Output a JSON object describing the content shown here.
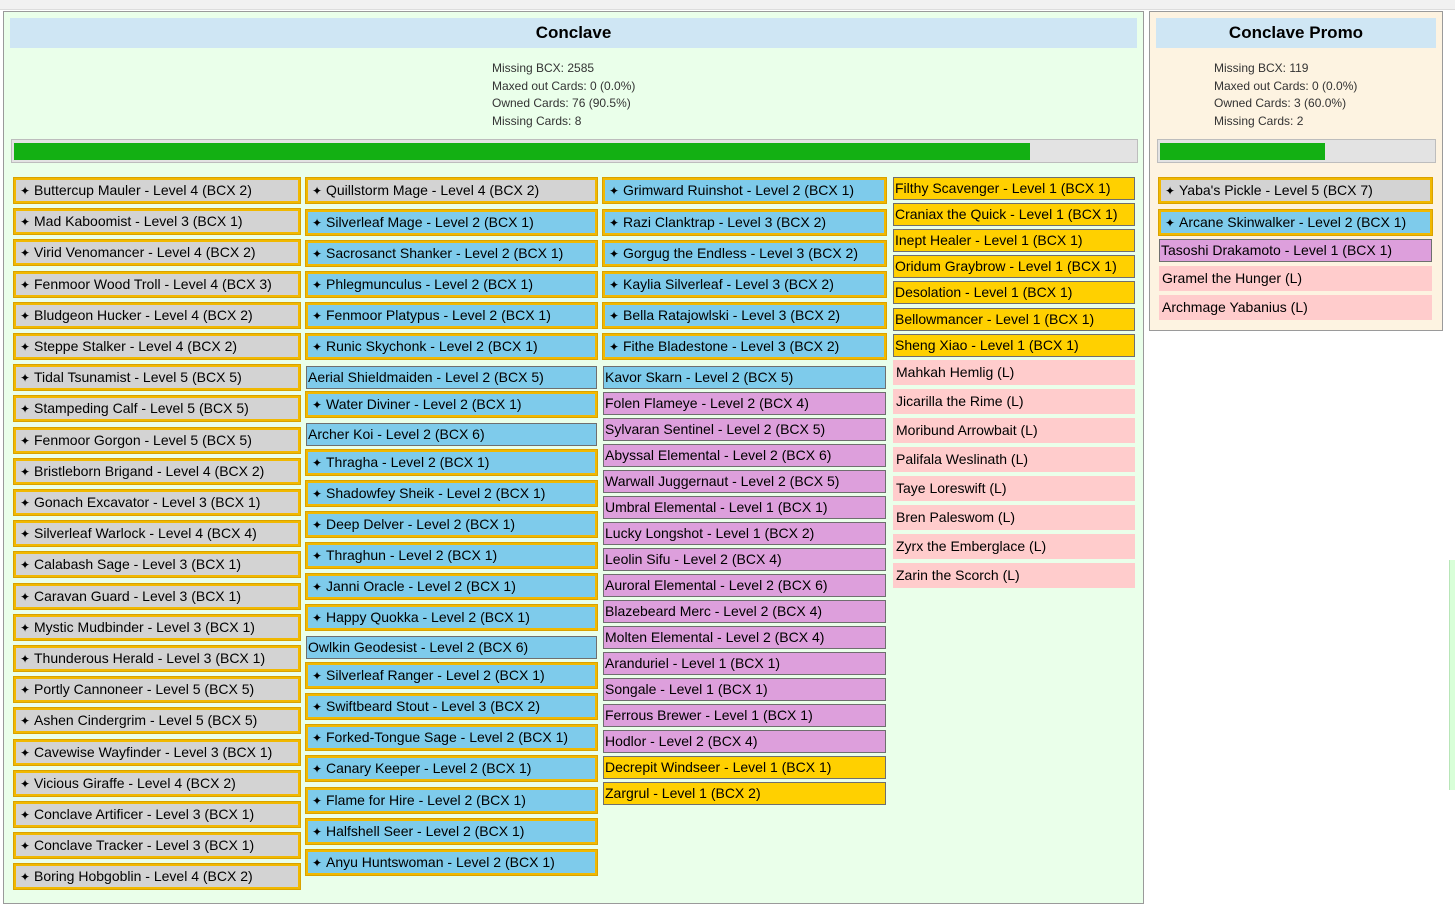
{
  "panels": {
    "main": {
      "title": "Conclave",
      "stats": [
        "Missing BCX: 2585",
        "Maxed out Cards: 0 (0.0%)",
        "Owned Cards: 76 (90.5%)",
        "Missing Cards: 8"
      ],
      "progress": 0.905,
      "columns": [
        {
          "color": "gray",
          "cards": [
            {
              "label": "Buttercup Mauler - Level 4 (BCX 2)",
              "icon": "star-icon",
              "style": "star"
            },
            {
              "label": "Mad Kaboomist - Level 3 (BCX 1)",
              "icon": "star-icon",
              "style": "star"
            },
            {
              "label": "Virid Venomancer - Level 4 (BCX 2)",
              "icon": "star-icon",
              "style": "star"
            },
            {
              "label": "Fenmoor Wood Troll - Level 4 (BCX 3)",
              "icon": "star-icon",
              "style": "star"
            },
            {
              "label": "Bludgeon Hucker - Level 4 (BCX 2)",
              "icon": "star-icon",
              "style": "star"
            },
            {
              "label": "Steppe Stalker - Level 4 (BCX 2)",
              "icon": "star-icon",
              "style": "star"
            },
            {
              "label": "Tidal Tsunamist - Level 5 (BCX 5)",
              "icon": "star-icon",
              "style": "star"
            },
            {
              "label": "Stampeding Calf - Level 5 (BCX 5)",
              "icon": "star-icon",
              "style": "star"
            },
            {
              "label": "Fenmoor Gorgon - Level 5 (BCX 5)",
              "icon": "star-icon",
              "style": "star"
            },
            {
              "label": "Bristleborn Brigand - Level 4 (BCX 2)",
              "icon": "star-icon",
              "style": "star"
            },
            {
              "label": "Gonach Excavator - Level 3 (BCX 1)",
              "icon": "star-icon",
              "style": "star"
            },
            {
              "label": "Silverleaf Warlock - Level 4 (BCX 4)",
              "icon": "star-icon",
              "style": "star"
            },
            {
              "label": "Calabash Sage - Level 3 (BCX 1)",
              "icon": "star-icon",
              "style": "star"
            },
            {
              "label": "Caravan Guard - Level 3 (BCX 1)",
              "icon": "star-icon",
              "style": "star"
            },
            {
              "label": "Mystic Mudbinder - Level 3 (BCX 1)",
              "icon": "star-icon",
              "style": "star"
            },
            {
              "label": "Thunderous Herald - Level 3 (BCX 1)",
              "icon": "star-icon",
              "style": "star"
            },
            {
              "label": "Portly Cannoneer - Level 5 (BCX 5)",
              "icon": "star-icon",
              "style": "star"
            },
            {
              "label": "Ashen Cindergrim - Level 5 (BCX 5)",
              "icon": "star-icon",
              "style": "star"
            },
            {
              "label": "Cavewise Wayfinder - Level 3 (BCX 1)",
              "icon": "star-icon",
              "style": "star"
            },
            {
              "label": "Vicious Giraffe - Level 4 (BCX 2)",
              "icon": "star-icon",
              "style": "star"
            },
            {
              "label": "Conclave Artificer - Level 3 (BCX 1)",
              "icon": "star-icon",
              "style": "star"
            },
            {
              "label": "Conclave Tracker - Level 3 (BCX 1)",
              "icon": "star-icon",
              "style": "star"
            },
            {
              "label": "Boring Hobgoblin - Level 4 (BCX 2)",
              "icon": "star-icon",
              "style": "star"
            }
          ]
        },
        {
          "color": "blue",
          "cards": [
            {
              "label": "Quillstorm Mage - Level 4 (BCX 2)",
              "icon": "star-icon",
              "style": "star",
              "bg": "gray"
            },
            {
              "label": "Silverleaf Mage - Level 2 (BCX 1)",
              "icon": "star-icon",
              "style": "star"
            },
            {
              "label": "Sacrosanct Shanker - Level 2 (BCX 1)",
              "icon": "star-icon",
              "style": "star"
            },
            {
              "label": "Phlegmunculus - Level 2 (BCX 1)",
              "icon": "star-icon",
              "style": "star"
            },
            {
              "label": "Fenmoor Platypus - Level 2 (BCX 1)",
              "icon": "star-icon",
              "style": "star"
            },
            {
              "label": "Runic Skychonk - Level 2 (BCX 1)",
              "icon": "star-icon",
              "style": "star"
            },
            {
              "label": "Aerial Shieldmaiden - Level 2 (BCX 5)",
              "icon": "",
              "style": "plain"
            },
            {
              "label": "Water Diviner - Level 2 (BCX 1)",
              "icon": "star-icon",
              "style": "star"
            },
            {
              "label": "Archer Koi - Level 2 (BCX 6)",
              "icon": "",
              "style": "plain"
            },
            {
              "label": "Thragha - Level 2 (BCX 1)",
              "icon": "star-icon",
              "style": "star"
            },
            {
              "label": "Shadowfey Sheik - Level 2 (BCX 1)",
              "icon": "star-icon",
              "style": "star"
            },
            {
              "label": "Deep Delver - Level 2 (BCX 1)",
              "icon": "star-icon",
              "style": "star"
            },
            {
              "label": "Thraghun - Level 2 (BCX 1)",
              "icon": "star-icon",
              "style": "star"
            },
            {
              "label": "Janni Oracle - Level 2 (BCX 1)",
              "icon": "star-icon",
              "style": "star"
            },
            {
              "label": "Happy Quokka - Level 2 (BCX 1)",
              "icon": "star-icon",
              "style": "star"
            },
            {
              "label": "Owlkin Geodesist - Level 2 (BCX 6)",
              "icon": "",
              "style": "plain"
            },
            {
              "label": "Silverleaf Ranger - Level 2 (BCX 1)",
              "icon": "star-icon",
              "style": "star"
            },
            {
              "label": "Swiftbeard Stout - Level 3 (BCX 2)",
              "icon": "star-icon",
              "style": "star"
            },
            {
              "label": "Forked-Tongue Sage - Level 2 (BCX 1)",
              "icon": "star-icon",
              "style": "star"
            },
            {
              "label": "Canary Keeper - Level 2 (BCX 1)",
              "icon": "star-icon",
              "style": "star"
            },
            {
              "label": "Flame for Hire - Level 2 (BCX 1)",
              "icon": "star-icon",
              "style": "star"
            },
            {
              "label": "Halfshell Seer - Level 2 (BCX 1)",
              "icon": "star-icon",
              "style": "star"
            },
            {
              "label": "Anyu Huntswoman - Level 2 (BCX 1)",
              "icon": "star-icon",
              "style": "star"
            }
          ]
        },
        {
          "color": "blue",
          "cards": [
            {
              "label": "Grimward Ruinshot - Level 2 (BCX 1)",
              "icon": "star-icon",
              "style": "star"
            },
            {
              "label": "Razi Clanktrap - Level 3 (BCX 2)",
              "icon": "star-icon",
              "style": "star"
            },
            {
              "label": "Gorgug the Endless - Level 3 (BCX 2)",
              "icon": "star-icon",
              "style": "star"
            },
            {
              "label": "Kaylia Silverleaf - Level 3 (BCX 2)",
              "icon": "star-icon",
              "style": "star"
            },
            {
              "label": "Bella Ratajowlski - Level 3 (BCX 2)",
              "icon": "star-icon",
              "style": "star"
            },
            {
              "label": "Fithe Bladestone - Level 3 (BCX 2)",
              "icon": "star-icon",
              "style": "star"
            },
            {
              "label": "Kavor Skarn - Level 2 (BCX 5)",
              "icon": "",
              "style": "plain",
              "bg": "blue"
            },
            {
              "label": "Folen Flameye - Level 2 (BCX 4)",
              "icon": "",
              "style": "plain",
              "bg": "purple"
            },
            {
              "label": "Sylvaran Sentinel - Level 2 (BCX 5)",
              "icon": "",
              "style": "plain",
              "bg": "purple"
            },
            {
              "label": "Abyssal Elemental - Level 2 (BCX 6)",
              "icon": "",
              "style": "plain",
              "bg": "purple"
            },
            {
              "label": "Warwall Juggernaut - Level 2 (BCX 5)",
              "icon": "",
              "style": "plain",
              "bg": "purple"
            },
            {
              "label": "Umbral Elemental - Level 1 (BCX 1)",
              "icon": "",
              "style": "plain",
              "bg": "purple"
            },
            {
              "label": "Lucky Longshot - Level 1 (BCX 2)",
              "icon": "",
              "style": "plain",
              "bg": "purple"
            },
            {
              "label": "Leolin Sifu - Level 2 (BCX 4)",
              "icon": "",
              "style": "plain",
              "bg": "purple"
            },
            {
              "label": "Auroral Elemental - Level 2 (BCX 6)",
              "icon": "",
              "style": "plain",
              "bg": "purple"
            },
            {
              "label": "Blazebeard Merc - Level 2 (BCX 4)",
              "icon": "",
              "style": "plain",
              "bg": "purple"
            },
            {
              "label": "Molten Elemental - Level 2 (BCX 4)",
              "icon": "",
              "style": "plain",
              "bg": "purple"
            },
            {
              "label": "Aranduriel - Level 1 (BCX 1)",
              "icon": "",
              "style": "plain",
              "bg": "purple"
            },
            {
              "label": "Songale - Level 1 (BCX 1)",
              "icon": "",
              "style": "plain",
              "bg": "purple"
            },
            {
              "label": "Ferrous Brewer - Level 1 (BCX 1)",
              "icon": "",
              "style": "plain",
              "bg": "purple"
            },
            {
              "label": "Hodlor - Level 2 (BCX 4)",
              "icon": "",
              "style": "plain",
              "bg": "purple"
            },
            {
              "label": "Decrepit Windseer - Level 1 (BCX 1)",
              "icon": "",
              "style": "plain",
              "bg": "gold"
            },
            {
              "label": "Zargrul - Level 1 (BCX 2)",
              "icon": "",
              "style": "plain",
              "bg": "gold"
            }
          ]
        },
        {
          "color": "gold",
          "cards": [
            {
              "label": "Filthy Scavenger - Level 1 (BCX 1)",
              "icon": "",
              "style": "plain",
              "bg": "gold"
            },
            {
              "label": "Craniax the Quick - Level 1 (BCX 1)",
              "icon": "",
              "style": "plain",
              "bg": "gold"
            },
            {
              "label": "Inept Healer - Level 1 (BCX 1)",
              "icon": "",
              "style": "plain",
              "bg": "gold"
            },
            {
              "label": "Oridum Graybrow - Level 1 (BCX 1)",
              "icon": "",
              "style": "plain",
              "bg": "gold"
            },
            {
              "label": "Desolation - Level 1 (BCX 1)",
              "icon": "",
              "style": "plain",
              "bg": "gold"
            },
            {
              "label": "Bellowmancer - Level 1 (BCX 1)",
              "icon": "",
              "style": "plain",
              "bg": "gold"
            },
            {
              "label": "Sheng Xiao - Level 1 (BCX 1)",
              "icon": "",
              "style": "plain",
              "bg": "gold"
            },
            {
              "label": "Mahkah Hemlig (L)",
              "icon": "",
              "style": "leg",
              "bg": "pink"
            },
            {
              "label": "Jicarilla the Rime (L)",
              "icon": "",
              "style": "leg",
              "bg": "pink"
            },
            {
              "label": "Moribund Arrowbait (L)",
              "icon": "",
              "style": "leg",
              "bg": "pink"
            },
            {
              "label": "Palifala Weslinath (L)",
              "icon": "",
              "style": "leg",
              "bg": "pink"
            },
            {
              "label": "Taye Loreswift (L)",
              "icon": "",
              "style": "leg",
              "bg": "pink"
            },
            {
              "label": "Bren Paleswom (L)",
              "icon": "",
              "style": "leg",
              "bg": "pink"
            },
            {
              "label": "Zyrx the Emberglace (L)",
              "icon": "",
              "style": "leg",
              "bg": "pink"
            },
            {
              "label": "Zarin the Scorch (L)",
              "icon": "",
              "style": "leg",
              "bg": "pink"
            }
          ]
        }
      ]
    },
    "promo": {
      "title": "Conclave Promo",
      "stats": [
        "Missing BCX: 119",
        "Maxed out Cards: 0 (0.0%)",
        "Owned Cards: 3 (60.0%)",
        "Missing Cards: 2"
      ],
      "progress": 0.6,
      "cards": [
        {
          "label": "Yaba's Pickle - Level 5 (BCX 7)",
          "icon": "star-icon",
          "style": "star",
          "bg": "gray"
        },
        {
          "label": "Arcane Skinwalker - Level 2 (BCX 1)",
          "icon": "star-icon",
          "style": "star",
          "bg": "blue"
        },
        {
          "label": "Tasoshi Drakamoto - Level 1 (BCX 1)",
          "icon": "",
          "style": "plain",
          "bg": "purple"
        },
        {
          "label": "Gramel the Hunger (L)",
          "icon": "",
          "style": "leg",
          "bg": "pink"
        },
        {
          "label": "Archmage Yabanius (L)",
          "icon": "",
          "style": "leg",
          "bg": "pink"
        }
      ]
    }
  },
  "colors": {
    "gray": "#d3d3d3",
    "blue": "#7ecbeb",
    "purple": "#dd9fdc",
    "gold": "#ffd000",
    "pink": "#ffcccc",
    "progress": "#13b013",
    "star_border": "#f1b800"
  }
}
